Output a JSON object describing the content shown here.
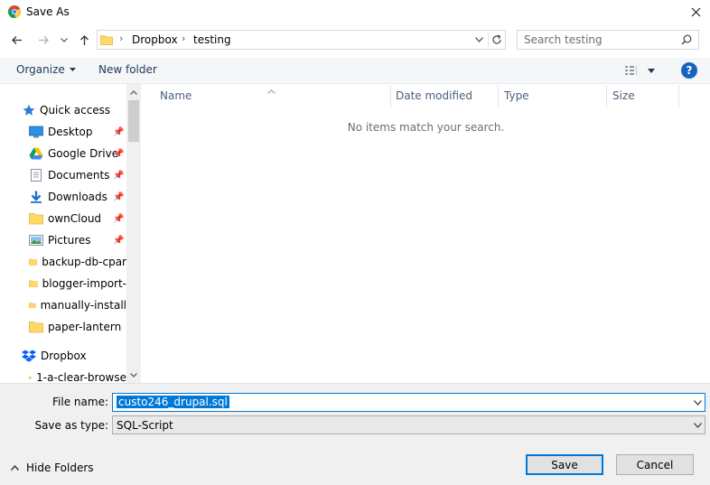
{
  "window": {
    "title": "Save As"
  },
  "navigation": {
    "back_icon": "arrow-left",
    "forward_icon": "arrow-right",
    "recent_icon": "chevron-down",
    "up_icon": "arrow-up"
  },
  "address": {
    "path": [
      "Dropbox",
      "testing"
    ]
  },
  "search": {
    "placeholder": "Search testing"
  },
  "toolbar": {
    "organize": "Organize",
    "new_folder": "New folder",
    "help": "?"
  },
  "sidebar": {
    "quick_access": "Quick access",
    "items": [
      {
        "label": "Desktop",
        "icon": "desktop-icon",
        "pinned": true
      },
      {
        "label": "Google Drive",
        "icon": "google-drive-icon",
        "pinned": true
      },
      {
        "label": "Documents",
        "icon": "documents-icon",
        "pinned": true
      },
      {
        "label": "Downloads",
        "icon": "downloads-icon",
        "pinned": true
      },
      {
        "label": "ownCloud",
        "icon": "folder-icon",
        "pinned": true
      },
      {
        "label": "Pictures",
        "icon": "pictures-icon",
        "pinned": true
      },
      {
        "label": "backup-db-cpar",
        "icon": "folder-icon",
        "pinned": false
      },
      {
        "label": "blogger-import-",
        "icon": "folder-icon",
        "pinned": false
      },
      {
        "label": "manually-install",
        "icon": "folder-icon",
        "pinned": false
      },
      {
        "label": "paper-lantern",
        "icon": "folder-icon",
        "pinned": false
      }
    ],
    "dropbox": "Dropbox",
    "dropbox_child": "1-a-clear-browse"
  },
  "columns": [
    "Name",
    "Date modified",
    "Type",
    "Size"
  ],
  "empty_message": "No items match your search.",
  "form": {
    "file_name_label": "File name:",
    "file_name_value": "custo246_drupal.sql",
    "save_type_label": "Save as type:",
    "save_type_value": "SQL-Script"
  },
  "buttons": {
    "hide_folders": "Hide Folders",
    "save": "Save",
    "cancel": "Cancel"
  },
  "colors": {
    "accent": "#0078d7",
    "folder": "#ffd867",
    "toolbar_bg": "#f5f6f7",
    "panel_bg": "#f0f0f0"
  }
}
